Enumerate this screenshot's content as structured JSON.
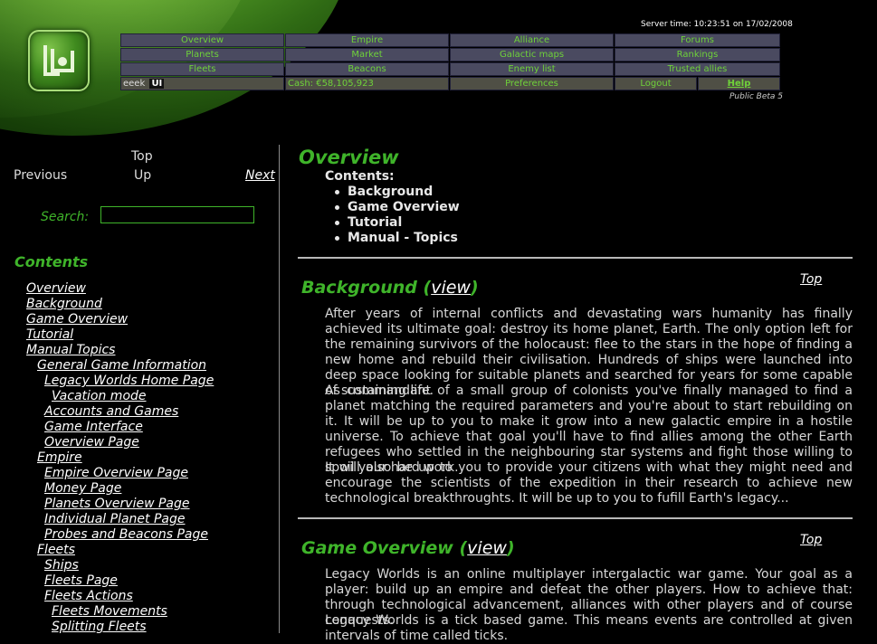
{
  "header": {
    "server_time": "Server time: 10:23:51 on 17/02/2008",
    "beta": "Public Beta 5",
    "nav": {
      "overview": "Overview",
      "empire": "Empire",
      "alliance": "Alliance",
      "forums": "Forums",
      "planets": "Planets",
      "market": "Market",
      "galactic_maps": "Galactic maps",
      "rankings": "Rankings",
      "fleets": "Fleets",
      "beacons": "Beacons",
      "enemy_list": "Enemy list",
      "trusted_allies": "Trusted allies",
      "user": "eeek",
      "ui_badge": "UI",
      "cash": "Cash: €58,105,923",
      "preferences": "Preferences",
      "logout": "Logout",
      "help": "Help"
    }
  },
  "sidebar": {
    "top": "Top",
    "previous": "Previous",
    "up": "Up",
    "next": "Next",
    "search_label": "Search:",
    "search_value": "",
    "contents_title": "Contents",
    "toc": [
      {
        "label": "Overview",
        "indent": 0
      },
      {
        "label": "Background",
        "indent": 0
      },
      {
        "label": "Game Overview",
        "indent": 0
      },
      {
        "label": "Tutorial",
        "indent": 0
      },
      {
        "label": "Manual Topics",
        "indent": 0
      },
      {
        "label": "General Game Information",
        "indent": 1
      },
      {
        "label": "Legacy Worlds Home Page",
        "indent": 2
      },
      {
        "label": "Vacation mode",
        "indent": 3
      },
      {
        "label": "Accounts and Games",
        "indent": 2
      },
      {
        "label": "Game Interface",
        "indent": 2
      },
      {
        "label": "Overview Page",
        "indent": 2
      },
      {
        "label": "Empire",
        "indent": 1
      },
      {
        "label": "Empire Overview Page",
        "indent": 2
      },
      {
        "label": "Money Page",
        "indent": 2
      },
      {
        "label": "Planets Overview Page",
        "indent": 2
      },
      {
        "label": "Individual Planet Page",
        "indent": 2
      },
      {
        "label": "Probes and Beacons Page",
        "indent": 2
      },
      {
        "label": "Fleets",
        "indent": 1
      },
      {
        "label": "Ships",
        "indent": 2
      },
      {
        "label": "Fleets Page",
        "indent": 2
      },
      {
        "label": "Fleets Actions",
        "indent": 2
      },
      {
        "label": "Fleets Movements",
        "indent": 3
      },
      {
        "label": "Splitting Fleets",
        "indent": 3
      }
    ]
  },
  "main": {
    "title": "Overview",
    "contents_heading": "Contents:",
    "contents": [
      "Background",
      "Game Overview",
      "Tutorial",
      "Manual - Topics"
    ],
    "top_label": "Top",
    "view_label": "view",
    "background": {
      "title": "Background",
      "paragraphs": [
        "After years of internal conflicts and devastating wars humanity has finally achieved its ultimate goal: destroy its home planet, Earth. The only option left for the remaining survivors of the holocaust: flee to the stars in the hope of finding a new home and rebuild their civilisation. Hundreds of ships were launched into deep space looking for suitable planets and searched for years for some capable of sustaining life.",
        "As commandant of a small group of colonists you've finally managed to find a planet matching the required parameters and you're about to start rebuilding on it. It will be up to you to make it grow into a new galactic empire in a hostile universe. To achieve that goal you'll have to find allies among the other Earth refugees who settled in the neighbouring star systems and fight those willing to spoil your hard work.",
        "It will also be up to you to provide your citizens with what they might need and encourage the scientists of the expedition in their research to achieve new technological breakthroughts. It will be up to you to fufill Earth's legacy..."
      ]
    },
    "game_overview": {
      "title": "Game Overview",
      "paragraphs": [
        "Legacy Worlds is an online multiplayer intergalactic war game. Your goal as a player: build up an empire and defeat the other players. How to achieve that: through technological advancement, alliances with other players and of course conquests.",
        "Legacy Worlds is a tick based game. This means events are controlled at given intervals of time called ticks."
      ]
    }
  }
}
